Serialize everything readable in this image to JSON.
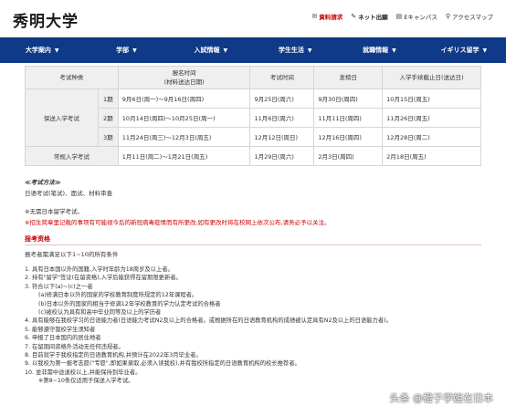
{
  "header": {
    "logo": "秀明大学",
    "links": [
      {
        "icon": "mail-icon",
        "label": "資料請求"
      },
      {
        "icon": "edit-icon",
        "label": "ネット出願"
      },
      {
        "icon": "book-icon",
        "label": "Eキャンパス"
      },
      {
        "icon": "location-pin-icon",
        "label": "アクセスマップ"
      }
    ]
  },
  "nav": [
    {
      "label": "大学案内"
    },
    {
      "label": "学部"
    },
    {
      "label": "入試情報"
    },
    {
      "label": "学生生活"
    },
    {
      "label": "就職情報"
    },
    {
      "label": "イギリス留学"
    }
  ],
  "schedule": {
    "headers": {
      "category": "考试种类",
      "period": "报名时间",
      "period_sub": "(材料送达日期)",
      "exam_date": "考试时间",
      "announce_date": "发榜日",
      "deadline": "入学手续截止日(送达日)"
    },
    "recommend": {
      "category": "保送入学考试",
      "rows": [
        {
          "phase": "1期",
          "period": "9月6日(周一)～9月16日(周四)",
          "exam": "9月25日(周六)",
          "announce": "9月30日(周四)",
          "deadline": "10月15日(周五)"
        },
        {
          "phase": "2期",
          "period": "10月14日(周四)～10月25日(周一)",
          "exam": "11月6日(周六)",
          "announce": "11月11日(周四)",
          "deadline": "11月26日(周五)"
        },
        {
          "phase": "3期",
          "period": "11月24日(周三)～12月3日(周五)",
          "exam": "12月12日(周日)",
          "announce": "12月16日(周四)",
          "deadline": "12月28日(周二)"
        }
      ]
    },
    "regular": {
      "category": "常规入学考试",
      "period": "1月11日(周二)～1月21日(周五)",
      "exam": "1月29日(周六)",
      "announce": "2月3日(周四)",
      "deadline": "2月18日(周五)"
    }
  },
  "method": {
    "title": "≪考试方法≫",
    "body": "日语考试(笔试)、面试、材料审查"
  },
  "notes": {
    "note1": "※无需日本留学考试。",
    "note2": "※招生简章里记载的事项有可能视今后的新冠病毒疫情而有所更改,如有更改时将在校网上依次公布,请务必予以关注。"
  },
  "requirements": {
    "title": "报考资格",
    "intro": "报考者需满足以下1~10的所有条件",
    "items": [
      {
        "text": "1. 具有日本国以外的国籍,入学时年龄为18周岁及以上者。",
        "sub": false
      },
      {
        "text": "2. 持有\"留学\"签证(在留资格),入学后能获得在留期限更新者。",
        "sub": false
      },
      {
        "text": "3. 符合以下(a)~(c)之一者",
        "sub": false
      },
      {
        "text": "(a)修满日本以外的国家的学校教育制度所规定的12年课程者。",
        "sub": true
      },
      {
        "text": "(b)日本以外的国家的相当于修满12年学校教育的学力认定考试的合格者",
        "sub": true
      },
      {
        "text": "(c)被校认为具有和高中毕业同等及以上的学历者",
        "sub": true
      },
      {
        "text": "4. 具有能够在我校学习的日语能力者(日语能力考试N2及以上的合格者。或根据所在的日语教育机构的成绩被认定具有N2及以上的日语能力者)。",
        "sub": false
      },
      {
        "text": "5. 能够遵守我校学生须知者",
        "sub": false
      },
      {
        "text": "6. 申报了日本国内的居住地者",
        "sub": false
      },
      {
        "text": "7. 在留期间资格外活动无任何违规者。",
        "sub": false
      },
      {
        "text": "8. 目前就学于我校指定的日语教育机构,并预计在2022年3月毕业者。",
        "sub": false
      },
      {
        "text": "9. 以我校为第一报考志愿(\"专愿\",即如果录取,必须入读我校),并有我校所指定的日语教育机构的校长推荐者。",
        "sub": false
      },
      {
        "text": "10. 並非需中途退校以上,并能保持到毕业者。",
        "sub": false
      },
      {
        "text": "※第8~10条仅适用于保送入学考试。",
        "sub": true
      }
    ]
  },
  "watermark": "头条 @橙子学姐在日本"
}
